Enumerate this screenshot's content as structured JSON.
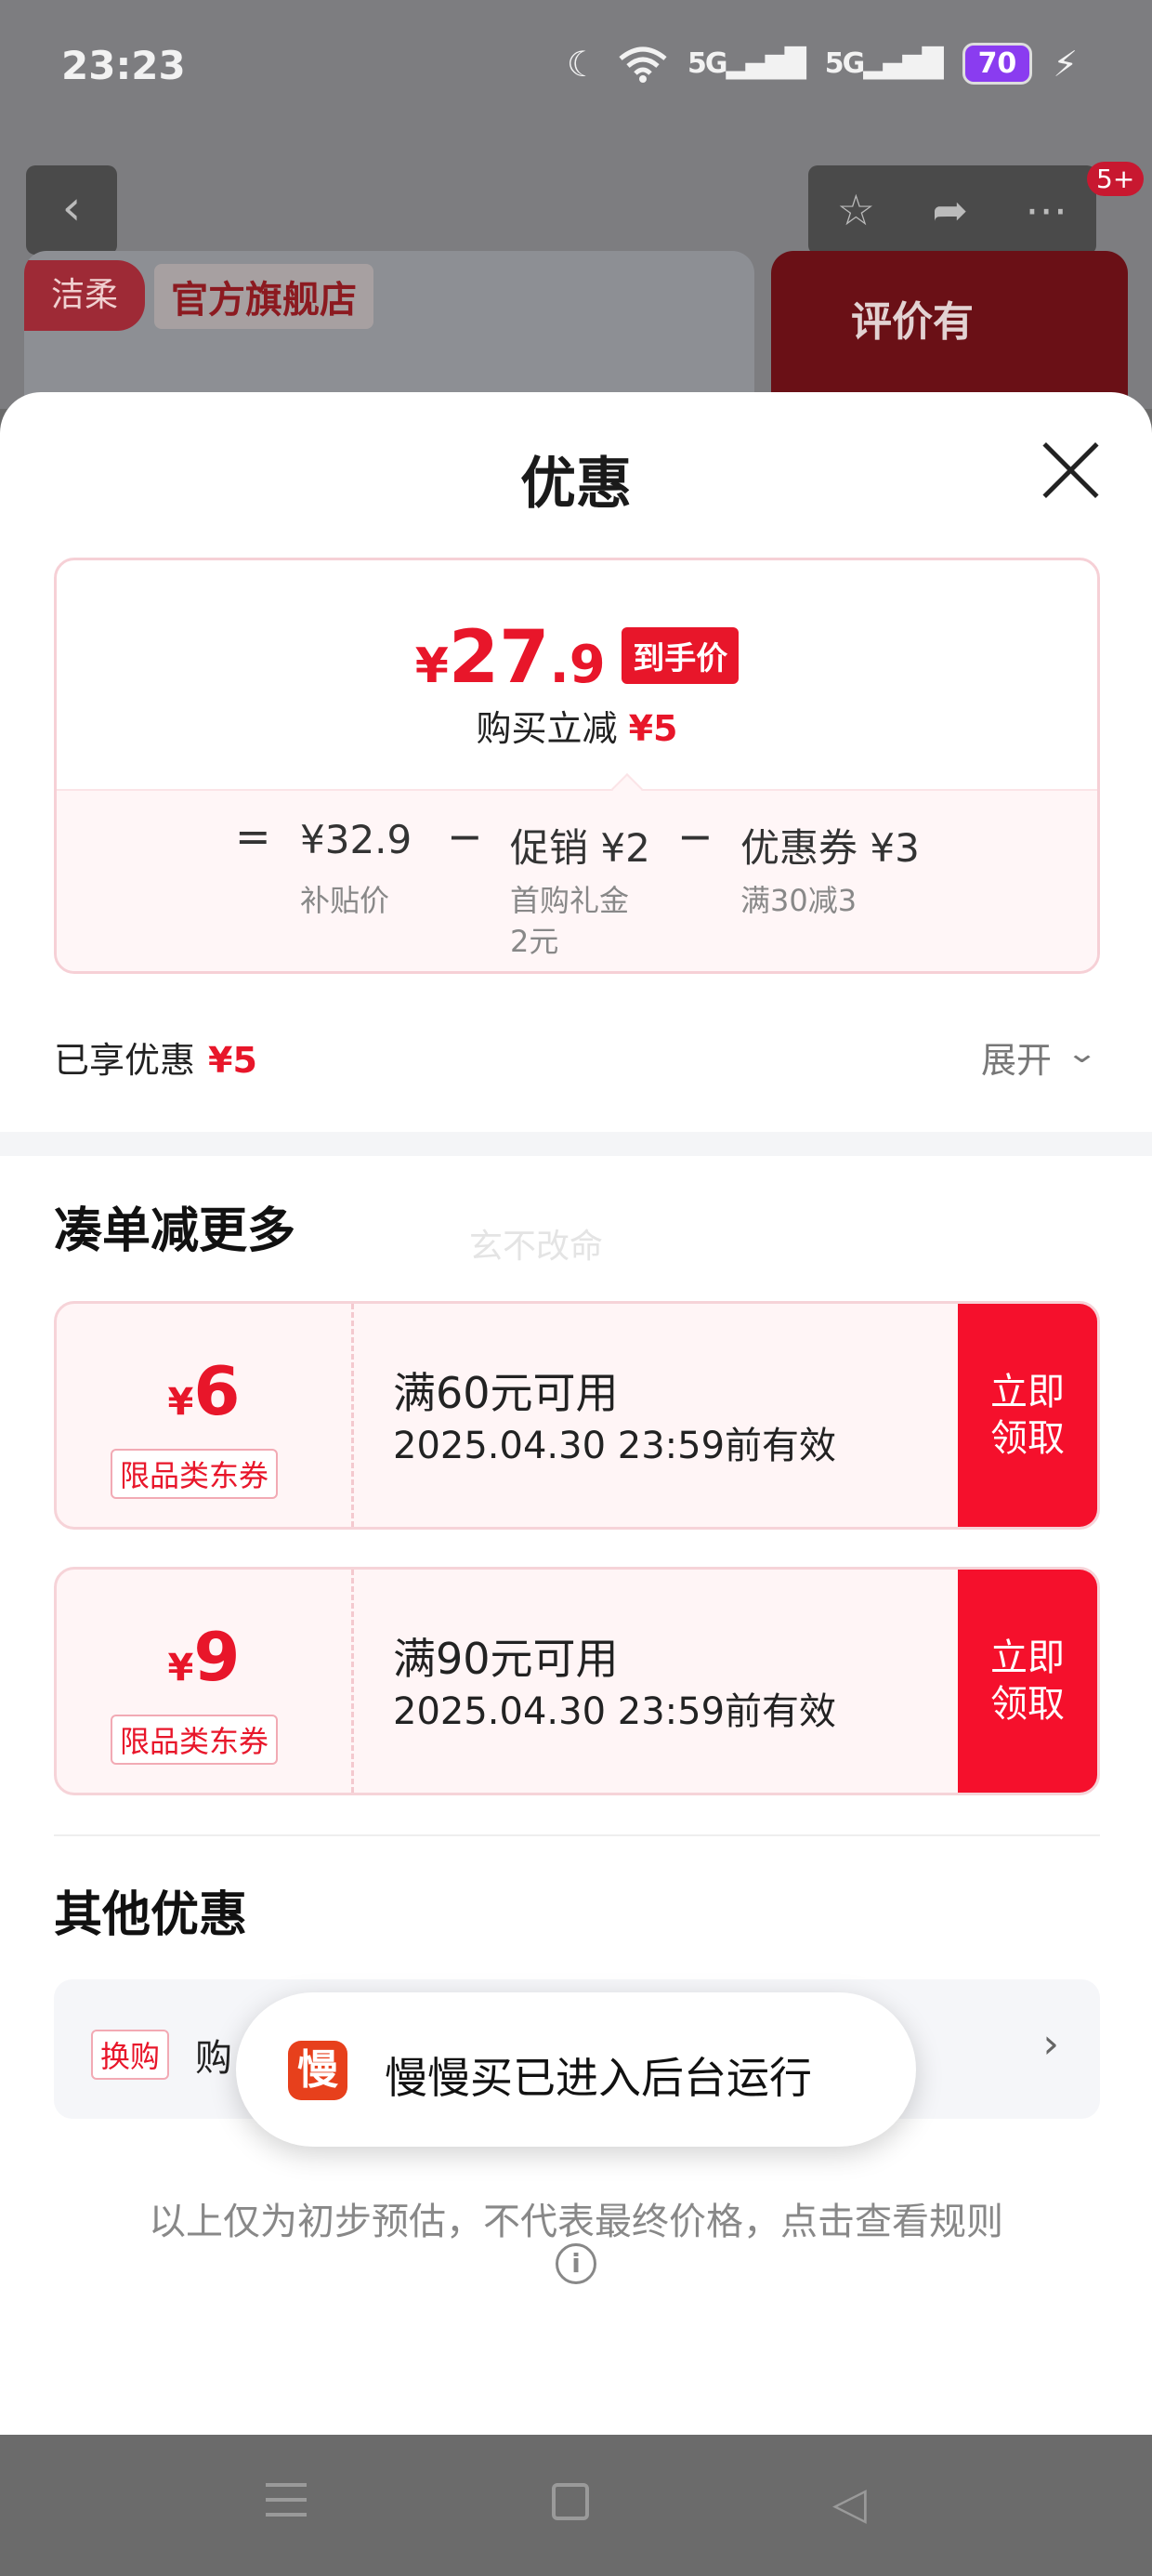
{
  "status_bar": {
    "time": "23:23",
    "moon_icon": "moon-icon",
    "wifi_icon": "wifi-icon",
    "signal1": "5G",
    "signal2": "5G",
    "battery": "70"
  },
  "background_page": {
    "shop_logo": "洁柔",
    "shop_label": "官方旗舰店",
    "review_label": "评价有",
    "cart_badge": "5+"
  },
  "sheet": {
    "title": "优惠",
    "price_card": {
      "currency": "¥",
      "price_int": "27",
      "price_dec": ".9",
      "price_tag": "到手价",
      "instant_label": "购买立减",
      "instant_value": "¥5",
      "breakdown": {
        "eq": "=",
        "subsidy_value": "¥32.9",
        "subsidy_label": "补贴价",
        "minus": "−",
        "promo_value": "促销 ¥2",
        "promo_label_line1": "首购礼金",
        "promo_label_line2": "2元",
        "coupon_value": "优惠券 ¥3",
        "coupon_label": "满30减3"
      }
    },
    "enjoyed_label": "已享优惠",
    "enjoyed_value": "¥5",
    "expand_label": "展开",
    "section1_title": "凑单减更多",
    "watermark": "玄不改命",
    "coupons": [
      {
        "currency": "¥",
        "amount": "6",
        "type": "限品类东券",
        "condition": "满60元可用",
        "expiry": "2025.04.30 23:59前有效",
        "button_line1": "立即",
        "button_line2": "领取"
      },
      {
        "currency": "¥",
        "amount": "9",
        "type": "限品类东券",
        "condition": "满90元可用",
        "expiry": "2025.04.30 23:59前有效",
        "button_line1": "立即",
        "button_line2": "领取"
      }
    ],
    "section2_title": "其他优惠",
    "other": {
      "tag": "换购",
      "text": "购"
    },
    "toast": {
      "icon_char": "慢",
      "text": "慢慢买已进入后台运行"
    },
    "disclaimer": "以上仅为初步预估，不代表最终价格，点击查看规则"
  },
  "colors": {
    "accent_red": "#e8162a",
    "button_red": "#f5102c",
    "battery_purple": "#8a3cf0"
  }
}
